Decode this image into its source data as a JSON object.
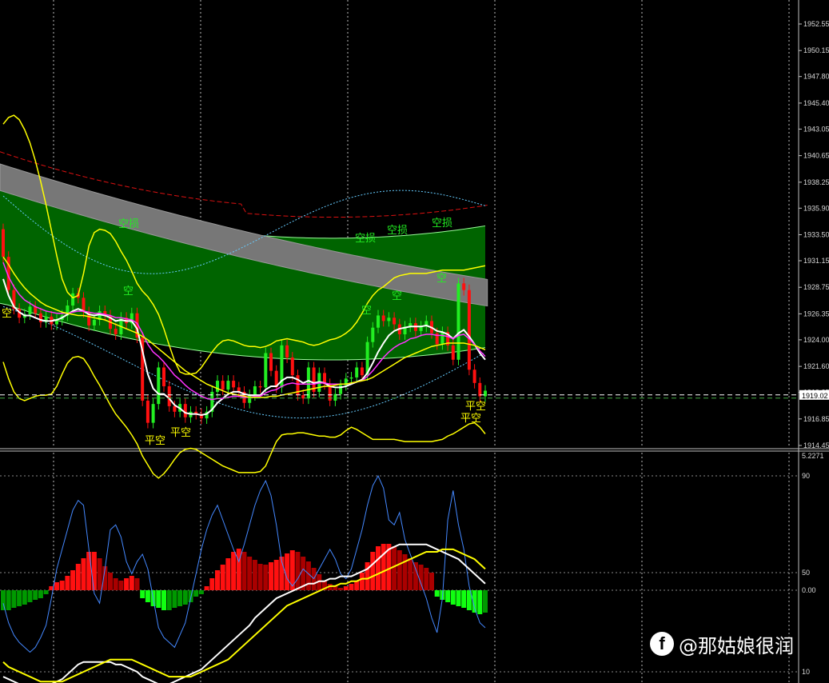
{
  "price_axis": {
    "labels": [
      "1952.55",
      "1950.15",
      "1947.80",
      "1945.40",
      "1943.05",
      "1940.65",
      "1938.25",
      "1935.90",
      "1933.50",
      "1931.15",
      "1928.75",
      "1926.35",
      "1924.00",
      "1921.60",
      "1919.25",
      "1916.85",
      "1914.45"
    ],
    "current_price": "1919.02"
  },
  "osc_axis": {
    "labels": [
      "5.2271",
      "90",
      "50",
      "0.00",
      "10"
    ]
  },
  "signals": [
    {
      "text": "空",
      "color": "#ffff00"
    },
    {
      "text": "空损",
      "color": "#22ee22"
    },
    {
      "text": "空",
      "color": "#22ee22"
    },
    {
      "text": "平空",
      "color": "#ffff00"
    },
    {
      "text": "平空",
      "color": "#ffff00"
    },
    {
      "text": "空损",
      "color": "#22ee22"
    },
    {
      "text": "空损",
      "color": "#22ee22"
    },
    {
      "text": "空损",
      "color": "#22ee22"
    },
    {
      "text": "空",
      "color": "#22ee22"
    },
    {
      "text": "空",
      "color": "#22ee22"
    },
    {
      "text": "空",
      "color": "#22ee22"
    },
    {
      "text": "平空",
      "color": "#ffff00"
    },
    {
      "text": "平空",
      "color": "#ffff00"
    }
  ],
  "watermark": {
    "logo": "f",
    "text": "@那姑娘很润"
  },
  "colors": {
    "bull": "#22ee22",
    "bear": "#ff1010",
    "channel": "#006400",
    "cloud": "#777777",
    "yellow": "#ffff00",
    "magenta": "#ff33ff"
  },
  "chart_data": [
    {
      "type": "candlestick",
      "ylim": [
        1914.45,
        1952.55
      ],
      "close_first": 1934.0,
      "closes": [
        1931.5,
        1928.5,
        1926.8,
        1926.0,
        1926.3,
        1927.0,
        1926.4,
        1925.6,
        1926.1,
        1925.4,
        1925.8,
        1926.2,
        1927.1,
        1928.2,
        1927.8,
        1926.5,
        1925.3,
        1925.8,
        1926.6,
        1926.2,
        1925.0,
        1924.5,
        1926.0,
        1925.5,
        1926.4,
        1924.2,
        1918.5,
        1916.5,
        1918.2,
        1921.5,
        1919.8,
        1918.0,
        1917.5,
        1918.2,
        1917.0,
        1917.5,
        1917.3,
        1916.9,
        1917.5,
        1919.3,
        1920.3,
        1919.5,
        1920.3,
        1919.7,
        1919.3,
        1918.3,
        1919.0,
        1919.8,
        1919.7,
        1922.8,
        1921.2,
        1919.7,
        1923.5,
        1922.4,
        1920.8,
        1919.0,
        1918.7,
        1921.5,
        1919.3,
        1921.0,
        1920.0,
        1918.5,
        1919.1,
        1919.9,
        1920.5,
        1920.6,
        1921.5,
        1920.8,
        1923.8,
        1925.1,
        1926.2,
        1925.7,
        1926.0,
        1925.4,
        1924.5,
        1925.2,
        1925.5,
        1924.8,
        1925.2,
        1925.7,
        1924.6,
        1923.6,
        1924.7,
        1923.5,
        1922.2,
        1929.1,
        1928.5,
        1921.3,
        1920.1,
        1918.9,
        1919.4
      ],
      "series": [
        {
          "name": "",
          "type": "line",
          "color": "#ffffff",
          "values": [
            1929.5,
            1928.0,
            1927.0,
            1926.5,
            1926.2,
            1926.2,
            1926.0,
            1925.8,
            1925.7,
            1925.7,
            1925.8,
            1926.0,
            1926.3,
            1926.6,
            1926.8,
            1926.6,
            1926.3,
            1926.2,
            1926.3,
            1926.2,
            1926.0,
            1925.7,
            1925.8,
            1925.7,
            1925.7,
            1925.0,
            1923.0,
            1920.9,
            1919.6,
            1919.1,
            1919.1,
            1918.7,
            1918.1,
            1917.8,
            1917.4,
            1917.3,
            1917.3,
            1917.2,
            1917.3,
            1917.7,
            1918.3,
            1918.7,
            1919.1,
            1919.3,
            1919.3,
            1919.1,
            1919.0,
            1919.0,
            1919.0,
            1919.5,
            1919.8,
            1919.8,
            1920.3,
            1920.6,
            1920.6,
            1920.4,
            1920.1,
            1920.3,
            1920.1,
            1920.2,
            1920.1,
            1919.8,
            1919.7,
            1919.7,
            1919.8,
            1920.0,
            1920.2,
            1920.4,
            1921.0,
            1921.9,
            1922.9,
            1923.7,
            1924.4,
            1924.8,
            1925.0,
            1925.1,
            1925.2,
            1925.2,
            1925.2,
            1925.3,
            1925.1,
            1924.8,
            1924.7,
            1924.5,
            1924.1,
            1924.6,
            1924.9,
            1924.3,
            1923.6,
            1922.8,
            1922.2
          ]
        },
        {
          "name": "",
          "type": "line",
          "color": "#ff33ff",
          "values": [
            1931.0,
            1929.7,
            1928.8,
            1928.1,
            1927.6,
            1927.3,
            1927.0,
            1926.8,
            1926.6,
            1926.5,
            1926.4,
            1926.4,
            1926.4,
            1926.5,
            1926.6,
            1926.6,
            1926.5,
            1926.4,
            1926.4,
            1926.3,
            1926.2,
            1926.0,
            1926.0,
            1925.9,
            1925.8,
            1925.5,
            1924.6,
            1923.6,
            1922.9,
            1922.5,
            1922.0,
            1921.4,
            1920.8,
            1920.4,
            1919.9,
            1919.5,
            1919.2,
            1918.9,
            1918.7,
            1918.6,
            1918.7,
            1918.7,
            1918.8,
            1918.9,
            1918.9,
            1918.8,
            1918.8,
            1918.9,
            1918.9,
            1919.2,
            1919.4,
            1919.5,
            1919.8,
            1920.0,
            1920.1,
            1920.0,
            1920.0,
            1920.0,
            1920.0,
            1920.1,
            1920.1,
            1920.0,
            1920.0,
            1920.0,
            1920.0,
            1920.1,
            1920.2,
            1920.3,
            1920.7,
            1921.2,
            1921.8,
            1922.4,
            1922.9,
            1923.3,
            1923.6,
            1923.8,
            1924.1,
            1924.2,
            1924.4,
            1924.5,
            1924.5,
            1924.4,
            1924.4,
            1924.3,
            1924.1,
            1924.4,
            1924.5,
            1924.1,
            1923.6,
            1923.0,
            1922.5
          ]
        },
        {
          "name": "",
          "type": "line",
          "color": "#ffff00",
          "values": [
            1931.5,
            1930.8,
            1930.0,
            1929.3,
            1928.7,
            1928.2,
            1927.8,
            1927.4,
            1927.1,
            1926.9,
            1926.7,
            1926.5,
            1926.4,
            1926.3,
            1926.2,
            1926.2,
            1926.1,
            1926.0,
            1925.9,
            1925.8,
            1925.6,
            1925.4,
            1925.2,
            1925.0,
            1924.8,
            1924.6,
            1924.3,
            1924.0,
            1923.6,
            1923.2,
            1922.8,
            1922.4,
            1922.0,
            1921.6,
            1921.2,
            1920.9,
            1920.6,
            1920.3,
            1920.0,
            1919.8,
            1919.6,
            1919.4,
            1919.2,
            1919.1,
            1919.0,
            1918.9,
            1918.8,
            1918.8,
            1918.8,
            1918.8,
            1918.9,
            1918.9,
            1919.0,
            1919.1,
            1919.2,
            1919.3,
            1919.4,
            1919.5,
            1919.6,
            1919.7,
            1919.8,
            1919.8,
            1919.9,
            1920.0,
            1920.0,
            1920.1,
            1920.2,
            1920.3,
            1920.4,
            1920.6,
            1920.9,
            1921.2,
            1921.5,
            1921.8,
            1922.1,
            1922.4,
            1922.6,
            1922.8,
            1923.0,
            1923.2,
            1923.4,
            1923.5,
            1923.6,
            1923.7,
            1923.7,
            1923.7,
            1923.7,
            1923.6,
            1923.5,
            1923.3,
            1923.1
          ]
        },
        {
          "name": "",
          "type": "line",
          "color": "#ffff00",
          "values": [
            1943.5,
            1944.1,
            1944.3,
            1943.9,
            1943.0,
            1941.8,
            1940.2,
            1938.3,
            1936.2,
            1933.9,
            1931.6,
            1929.5,
            1928.3,
            1927.8,
            1928.0,
            1930.0,
            1932.5,
            1933.7,
            1934.0,
            1933.9,
            1933.6,
            1932.9,
            1932.0,
            1931.2,
            1930.2,
            1929.1,
            1928.4,
            1927.9,
            1927.2,
            1926.3,
            1925.0,
            1923.5,
            1922.1,
            1921.1,
            1920.9,
            1920.9,
            1921.0,
            1921.5,
            1922.2,
            1922.9,
            1923.5,
            1923.9,
            1924.0,
            1923.9,
            1923.7,
            1923.5,
            1923.4,
            1923.4,
            1923.3,
            1923.4,
            1923.6,
            1923.9,
            1924.0,
            1924.1,
            1924.0,
            1923.9,
            1923.8,
            1923.6,
            1923.5,
            1923.6,
            1923.8,
            1924.0,
            1924.1,
            1924.3,
            1924.6,
            1925.0,
            1925.6,
            1926.4,
            1927.3,
            1928.0,
            1928.5,
            1928.8,
            1929.2,
            1929.6,
            1929.8,
            1929.9,
            1930.0,
            1930.0,
            1930.0,
            1930.0,
            1930.1,
            1930.2,
            1930.3,
            1930.3,
            1930.3,
            1930.3,
            1930.3,
            1930.4,
            1930.5,
            1930.6,
            1930.7
          ]
        },
        {
          "name": "",
          "type": "line",
          "color": "#ffff00",
          "values": [
            1922.0,
            1920.5,
            1919.3,
            1918.7,
            1918.5,
            1918.7,
            1918.9,
            1919.0,
            1919.0,
            1919.1,
            1919.8,
            1920.9,
            1921.9,
            1922.4,
            1922.5,
            1922.3,
            1921.6,
            1920.7,
            1919.9,
            1919.0,
            1918.1,
            1917.3,
            1916.7,
            1916.1,
            1915.4,
            1914.6,
            1913.5,
            1912.7,
            1911.9,
            1911.5,
            1911.9,
            1912.5,
            1913.2,
            1913.8,
            1914.1,
            1914.2,
            1914.1,
            1913.8,
            1913.5,
            1913.2,
            1912.9,
            1912.6,
            1912.4,
            1912.2,
            1912.0,
            1912.0,
            1912.0,
            1912.0,
            1912.1,
            1912.6,
            1913.7,
            1914.8,
            1915.4,
            1915.5,
            1915.5,
            1915.6,
            1915.6,
            1915.5,
            1915.4,
            1915.3,
            1915.3,
            1915.2,
            1915.2,
            1915.4,
            1915.8,
            1916.1,
            1915.9,
            1915.6,
            1915.3,
            1915.0,
            1915.0,
            1915.0,
            1915.0,
            1915.0,
            1914.9,
            1914.8,
            1914.8,
            1914.8,
            1914.8,
            1914.8,
            1914.8,
            1914.9,
            1915.0,
            1915.3,
            1915.5,
            1915.8,
            1916.1,
            1916.4,
            1916.5,
            1916.1,
            1915.5
          ]
        }
      ]
    },
    {
      "type": "bar",
      "ylim": [
        0,
        100
      ],
      "values": [
        -25,
        -25,
        -22,
        -20,
        -18,
        -15,
        -12,
        -10,
        -5,
        5,
        10,
        12,
        18,
        25,
        33,
        40,
        48,
        48,
        40,
        30,
        22,
        15,
        12,
        15,
        18,
        15,
        -10,
        -15,
        -20,
        -22,
        -25,
        -25,
        -22,
        -20,
        -18,
        -15,
        -8,
        -5,
        5,
        15,
        25,
        32,
        40,
        48,
        52,
        48,
        42,
        38,
        33,
        32,
        35,
        38,
        42,
        46,
        50,
        48,
        42,
        36,
        28,
        20,
        12,
        8,
        5,
        3,
        5,
        8,
        12,
        22,
        35,
        48,
        55,
        58,
        58,
        55,
        50,
        45,
        40,
        35,
        32,
        28,
        22,
        -8,
        -12,
        -15,
        -18,
        -20,
        -22,
        -25,
        -28,
        -30,
        -28
      ],
      "series": [
        {
          "name": "",
          "color": "#4488ff",
          "values": [
            38,
            30,
            25,
            22,
            20,
            18,
            20,
            24,
            29,
            40,
            52,
            60,
            68,
            76,
            80,
            78,
            60,
            42,
            38,
            52,
            68,
            70,
            65,
            55,
            50,
            55,
            58,
            52,
            40,
            28,
            24,
            22,
            20,
            25,
            30,
            40,
            50,
            60,
            68,
            74,
            78,
            72,
            66,
            60,
            55,
            62,
            70,
            78,
            84,
            88,
            82,
            70,
            55,
            48,
            45,
            48,
            52,
            50,
            48,
            52,
            56,
            60,
            56,
            50,
            48,
            52,
            60,
            68,
            78,
            86,
            90,
            85,
            72,
            70,
            75,
            64,
            58,
            52,
            46,
            40,
            32,
            26,
            40,
            72,
            84,
            70,
            60,
            45,
            36,
            30,
            28
          ]
        },
        {
          "name": "",
          "color": "#ffffff",
          "values": [
            8,
            7,
            6,
            5,
            5,
            4,
            4,
            4,
            4,
            5,
            6,
            7,
            9,
            11,
            13,
            14,
            14,
            14,
            14,
            14,
            14,
            13,
            13,
            12,
            11,
            10,
            8,
            7,
            6,
            5,
            5,
            5,
            6,
            7,
            8,
            9,
            10,
            11,
            13,
            15,
            17,
            19,
            21,
            23,
            25,
            27,
            29,
            32,
            34,
            36,
            38,
            40,
            41,
            42,
            43,
            44,
            45,
            46,
            46,
            47,
            47,
            48,
            48,
            49,
            49,
            49,
            50,
            51,
            52,
            54,
            56,
            58,
            60,
            61,
            62,
            62,
            62,
            62,
            62,
            62,
            61,
            60,
            59,
            58,
            57,
            56,
            54,
            52,
            50,
            48,
            46
          ]
        },
        {
          "name": "",
          "color": "#ffff00",
          "values": [
            14,
            12,
            11,
            10,
            9,
            8,
            7,
            6,
            6,
            6,
            6,
            6,
            7,
            8,
            9,
            10,
            11,
            12,
            13,
            14,
            15,
            15,
            15,
            15,
            15,
            14,
            13,
            12,
            11,
            10,
            9,
            8,
            8,
            8,
            8,
            8,
            9,
            10,
            11,
            12,
            13,
            14,
            15,
            17,
            19,
            21,
            23,
            25,
            27,
            29,
            31,
            33,
            35,
            37,
            38,
            39,
            40,
            41,
            42,
            43,
            44,
            45,
            45,
            46,
            46,
            47,
            47,
            48,
            48,
            49,
            50,
            51,
            52,
            53,
            54,
            55,
            56,
            57,
            58,
            59,
            59,
            59,
            60,
            60,
            60,
            59,
            58,
            57,
            56,
            54,
            52
          ]
        }
      ]
    }
  ]
}
